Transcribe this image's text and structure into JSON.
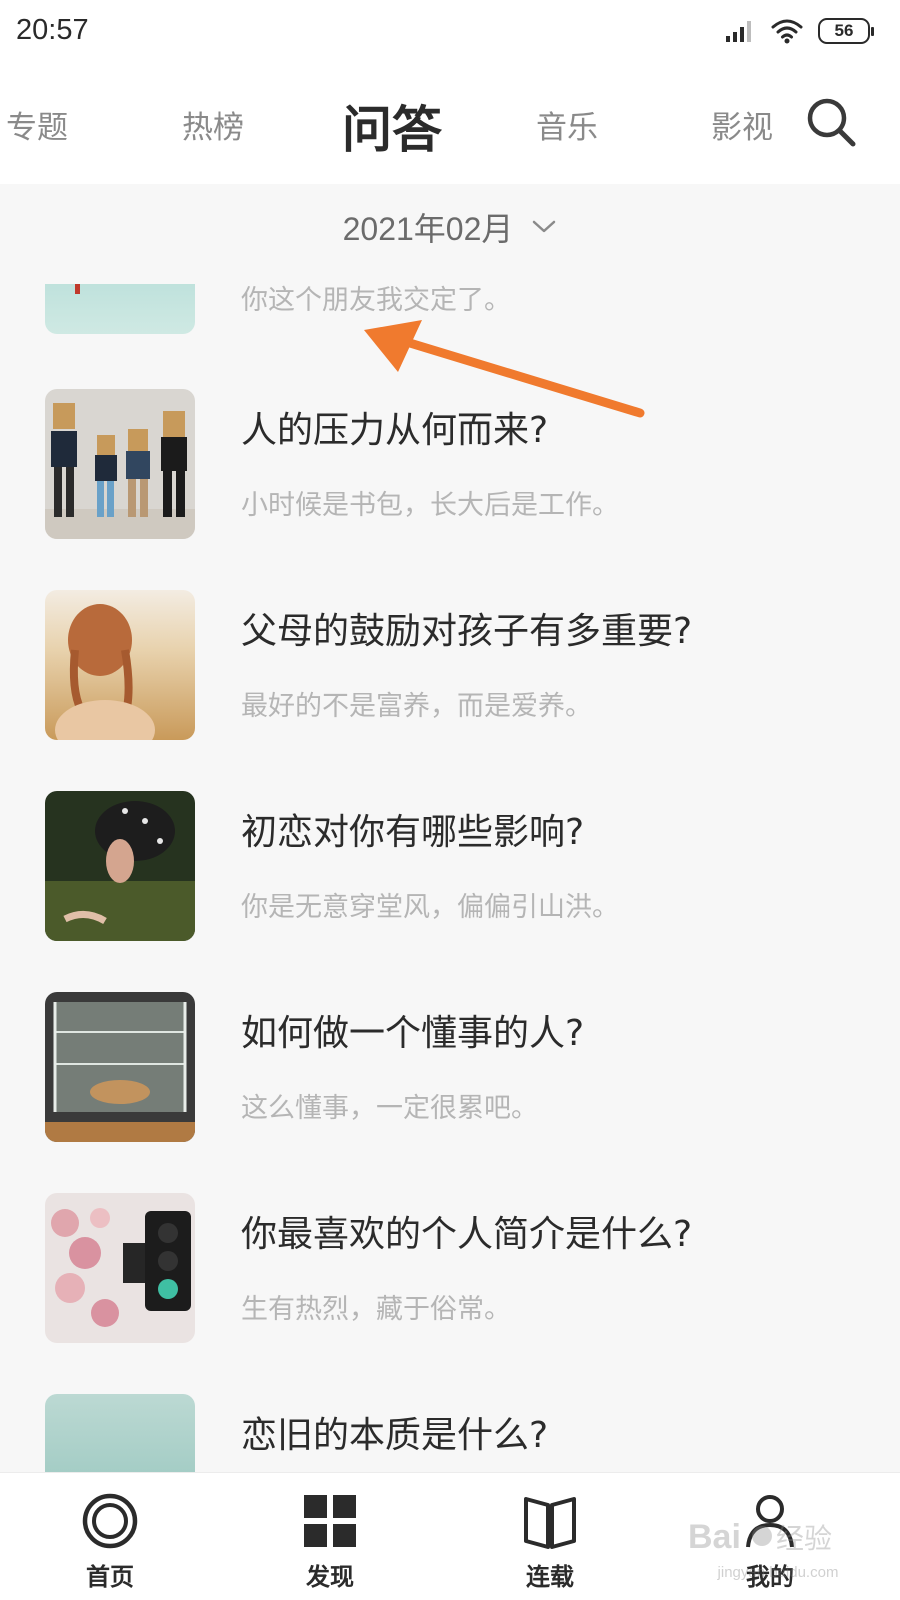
{
  "status_bar": {
    "time": "20:57",
    "battery": "56",
    "icons": [
      "signal-icon",
      "wifi-icon",
      "battery-icon"
    ]
  },
  "tabs": [
    {
      "label": "专题",
      "active": false
    },
    {
      "label": "热榜",
      "active": false
    },
    {
      "label": "问答",
      "active": true
    },
    {
      "label": "音乐",
      "active": false
    },
    {
      "label": "影视",
      "active": false
    }
  ],
  "search_icon": "search-icon",
  "date_selector": {
    "label": "2021年02月",
    "icon": "chevron-down-icon"
  },
  "items": [
    {
      "title": "",
      "subtitle": "你这个朋友我交定了。",
      "partial": true
    },
    {
      "title": "人的压力从何而来?",
      "subtitle": "小时候是书包，长大后是工作。"
    },
    {
      "title": "父母的鼓励对孩子有多重要?",
      "subtitle": "最好的不是富养，而是爱养。"
    },
    {
      "title": "初恋对你有哪些影响?",
      "subtitle": "你是无意穿堂风，偏偏引山洪。"
    },
    {
      "title": "如何做一个懂事的人?",
      "subtitle": "这么懂事，一定很累吧。"
    },
    {
      "title": "你最喜欢的个人简介是什么?",
      "subtitle": "生有热烈，藏于俗常。"
    },
    {
      "title": "恋旧的本质是什么?",
      "subtitle": "",
      "partial": true
    }
  ],
  "annotation_arrow_color": "#f07a2e",
  "bottom_nav": [
    {
      "label": "首页",
      "icon": "home-ring-icon"
    },
    {
      "label": "发现",
      "icon": "grid-icon"
    },
    {
      "label": "连载",
      "icon": "book-icon"
    },
    {
      "label": "我的",
      "icon": "user-icon"
    }
  ],
  "watermark": {
    "logo_text": "Baidu经验",
    "url_text": "jingyan.baidu.com"
  },
  "colors": {
    "background": "#f7f7f7",
    "title_text": "#2b2b2b",
    "subtitle_text": "#b5b5b5",
    "tab_inactive": "#8a8a8a"
  }
}
